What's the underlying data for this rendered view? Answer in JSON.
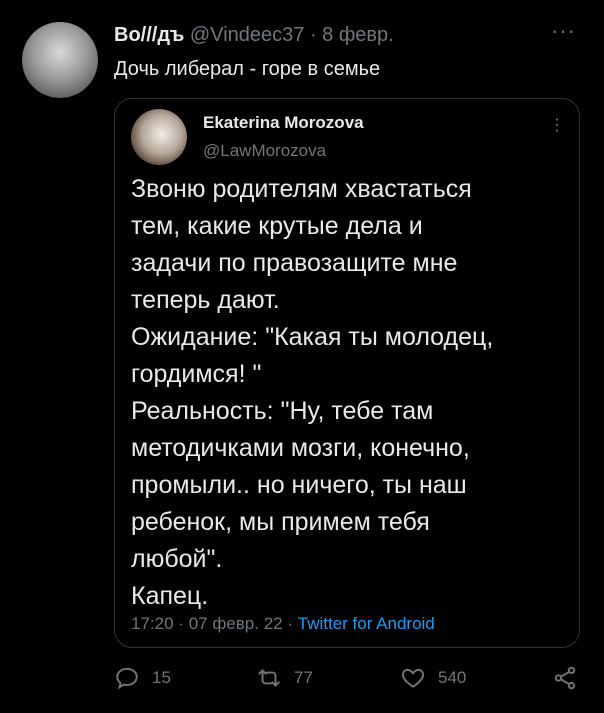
{
  "tweet": {
    "author_name": "Во///дъ",
    "author_handle": "@Vindeec37",
    "separator": "·",
    "date": "8 февр.",
    "more": "···",
    "text": "Дочь либерал - горе в семье"
  },
  "quoted": {
    "author_name": "Ekaterina Morozova",
    "author_handle": "@LawMorozova",
    "more": "⋮",
    "lines": [
      "Звоню родителям хвастаться",
      "тем, какие крутые дела и",
      "задачи по правозащите мне",
      "теперь дают.",
      "Ожидание: \"Какая ты молодец,",
      "гордимся! \"",
      "Реальность: \"Ну, тебе там",
      "методичками мозги, конечно,",
      "промыли.. но ничего, ты наш",
      "ребенок, мы примем тебя",
      "любой\".",
      "Капец."
    ],
    "time": "17:20",
    "sep1": "·",
    "date": "07 февр. 22",
    "sep2": "·",
    "source": "Twitter for Android"
  },
  "actions": {
    "replies": "15",
    "retweets": "77",
    "likes": "540"
  },
  "icons": {
    "reply": "reply-icon",
    "retweet": "retweet-icon",
    "like": "heart-icon",
    "share": "share-icon"
  },
  "colors": {
    "background": "#000000",
    "text": "#e7e9ea",
    "muted": "#71767b",
    "link": "#1d9bf0",
    "border": "#2f3336"
  }
}
